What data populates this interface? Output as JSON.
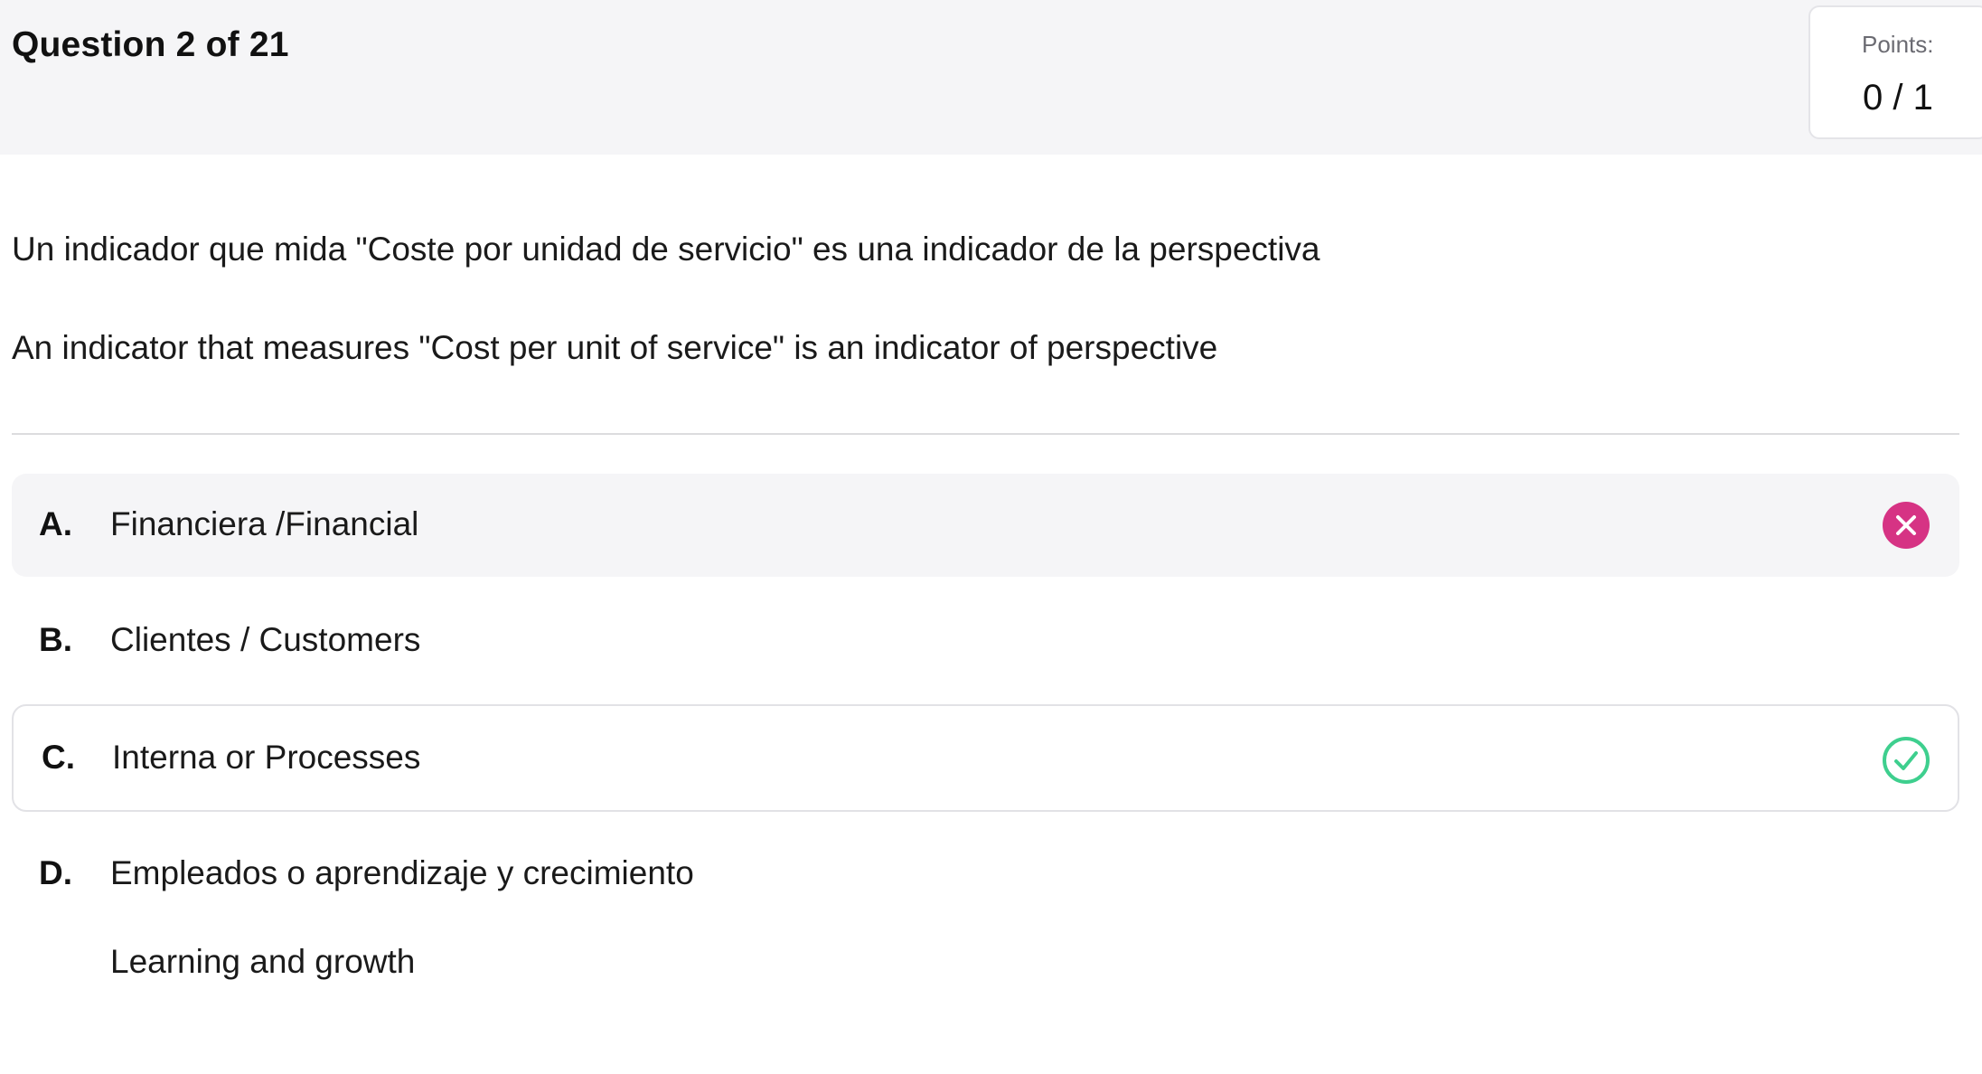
{
  "header": {
    "title": "Question 2 of 21",
    "points_label": "Points:",
    "points_value": "0 / 1"
  },
  "question": {
    "text_es": "Un indicador que mida \"Coste por unidad de servicio\" es una indicador de la perspectiva",
    "text_en": "An indicator that measures \"Cost per unit of service\" is an indicator of perspective"
  },
  "options": [
    {
      "letter": "A.",
      "text": "Financiera /Financial",
      "status": "incorrect-selected",
      "icon": "x-circle-icon",
      "icon_color": "#d63384"
    },
    {
      "letter": "B.",
      "text": "Clientes / Customers"
    },
    {
      "letter": "C.",
      "text": "Interna or Processes",
      "status": "correct",
      "icon": "check-circle-icon",
      "icon_color": "#3ecf8e"
    },
    {
      "letter": "D.",
      "text": "Empleados o aprendizaje y crecimiento",
      "text_2": "Learning and growth"
    }
  ]
}
